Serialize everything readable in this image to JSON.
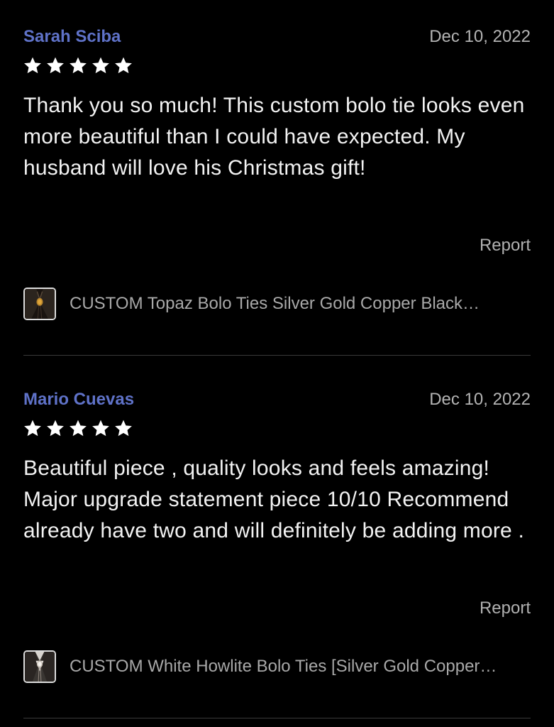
{
  "reviews": [
    {
      "reviewer": "Sarah Sciba",
      "date": "Dec 10, 2022",
      "rating": 5,
      "text": "Thank you so much! This custom bolo tie looks even more beautiful than I could have expected. My husband will love his Christmas gift!",
      "report_label": "Report",
      "product_title": "CUSTOM Topaz Bolo Ties Silver Gold Copper Black…"
    },
    {
      "reviewer": "Mario Cuevas",
      "date": "Dec 10, 2022",
      "rating": 5,
      "text": "Beautiful piece , quality looks and feels amazing!  Major upgrade statement piece 10/10 Recommend  already have two and will definitely be adding more .",
      "report_label": "Report",
      "product_title": "CUSTOM White Howlite Bolo Ties [Silver Gold Copper…"
    }
  ],
  "colors": {
    "background": "#000000",
    "reviewer_name": "#5f72c8",
    "star": "#ffffff",
    "muted_text": "#b3b3b3",
    "divider": "#3a3a3a"
  },
  "icons": {
    "star": "star-icon",
    "product_thumbnail_1": "bolo-tie-topaz-thumbnail",
    "product_thumbnail_2": "bolo-tie-howlite-thumbnail"
  }
}
